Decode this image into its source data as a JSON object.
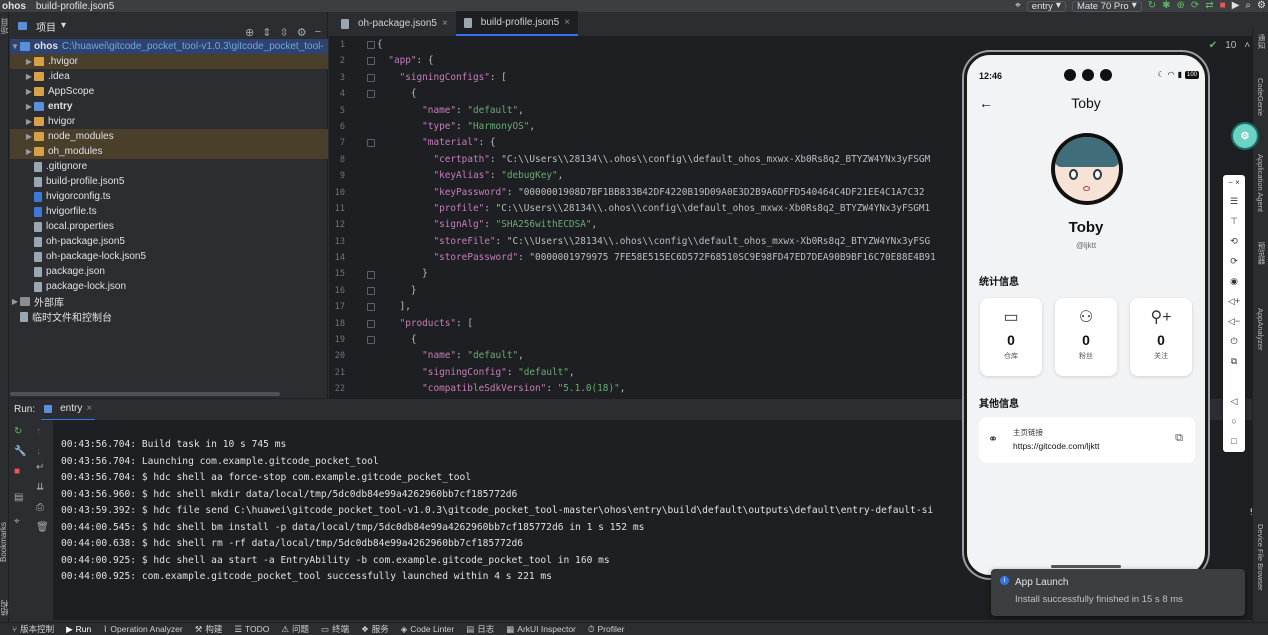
{
  "titlebar": {
    "project": "ohos",
    "file": "build-profile.json5",
    "run_config": "entry",
    "device": "Mate 70 Pro"
  },
  "project_panel": {
    "title": "项目",
    "root": {
      "name": "ohos",
      "path": "C:\\huawei\\gitcode_pocket_tool-v1.0.3\\gitcode_pocket_tool-"
    },
    "items": [
      {
        "name": ".hvigor",
        "type": "folder-excluded"
      },
      {
        "name": ".idea",
        "type": "folder"
      },
      {
        "name": "AppScope",
        "type": "folder"
      },
      {
        "name": "entry",
        "type": "folder-module"
      },
      {
        "name": "hvigor",
        "type": "folder"
      },
      {
        "name": "node_modules",
        "type": "folder-excluded"
      },
      {
        "name": "oh_modules",
        "type": "folder-excluded"
      },
      {
        "name": ".gitignore",
        "type": "file"
      },
      {
        "name": "build-profile.json5",
        "type": "file"
      },
      {
        "name": "hvigorconfig.ts",
        "type": "ts"
      },
      {
        "name": "hvigorfile.ts",
        "type": "ts"
      },
      {
        "name": "local.properties",
        "type": "file"
      },
      {
        "name": "oh-package.json5",
        "type": "file"
      },
      {
        "name": "oh-package-lock.json5",
        "type": "file"
      },
      {
        "name": "package.json",
        "type": "file"
      },
      {
        "name": "package-lock.json",
        "type": "file"
      }
    ],
    "external_libs": "外部库",
    "scratches": "临时文件和控制台"
  },
  "editor": {
    "tabs": [
      {
        "label": "oh-package.json5",
        "active": false
      },
      {
        "label": "build-profile.json5",
        "active": true
      }
    ],
    "inspection_count": "10",
    "lines": [
      {
        "n": "1",
        "t": "{"
      },
      {
        "n": "2",
        "t": "  \"app\": {"
      },
      {
        "n": "3",
        "t": "    \"signingConfigs\": ["
      },
      {
        "n": "4",
        "t": "      {"
      },
      {
        "n": "5",
        "t": "        \"name\": \"default\","
      },
      {
        "n": "6",
        "t": "        \"type\": \"HarmonyOS\","
      },
      {
        "n": "7",
        "t": "        \"material\": {"
      },
      {
        "n": "8",
        "t": "          \"certpath\": \"C:\\\\Users\\\\28134\\\\.ohos\\\\config\\\\default_ohos_mxwx-Xb0Rs8q2_BTYZW4YNx3yFSGM"
      },
      {
        "n": "9",
        "t": "          \"keyAlias\": \"debugKey\","
      },
      {
        "n": "10",
        "t": "          \"keyPassword\": \"0000001908D7BF1BB833B42DF4220B19D09A0E3D2B9A6DFFD540464C4DF21EE4C1A7C32"
      },
      {
        "n": "11",
        "t": "          \"profile\": \"C:\\\\Users\\\\28134\\\\.ohos\\\\config\\\\default_ohos_mxwx-Xb0Rs8q2_BTYZW4YNx3yFSGM1"
      },
      {
        "n": "12",
        "t": "          \"signAlg\": \"SHA256withECDSA\","
      },
      {
        "n": "13",
        "t": "          \"storeFile\": \"C:\\\\Users\\\\28134\\\\.ohos\\\\config\\\\default_ohos_mxwx-Xb0Rs8q2_BTYZW4YNx3yFSG"
      },
      {
        "n": "14",
        "t": "          \"storePassword\": \"0000001979975 7FE58E515EC6D572F68510SC9E98FD47ED7DEA90B9BF16C70E88E4B91"
      },
      {
        "n": "15",
        "t": "        }"
      },
      {
        "n": "16",
        "t": "      }"
      },
      {
        "n": "17",
        "t": "    ],"
      },
      {
        "n": "18",
        "t": "    \"products\": ["
      },
      {
        "n": "19",
        "t": "      {"
      },
      {
        "n": "20",
        "t": "        \"name\": \"default\","
      },
      {
        "n": "21",
        "t": "        \"signingConfig\": \"default\","
      },
      {
        "n": "22",
        "t": "        \"compatibleSdkVersion\": \"5.1.0(18)\","
      }
    ]
  },
  "run": {
    "label": "Run:",
    "tab": "entry",
    "log": [
      "00:43:56.704: Build task in 10 s 745 ms",
      "00:43:56.704: Launching com.example.gitcode_pocket_tool",
      "00:43:56.704: $ hdc shell aa force-stop com.example.gitcode_pocket_tool",
      "00:43:56.960: $ hdc shell mkdir data/local/tmp/5dc0db84e99a4262960bb7cf185772d6",
      "00:43:59.392: $ hdc file send C:\\huawei\\gitcode_pocket_tool-v1.0.3\\gitcode_pocket_tool-master\\ohos\\entry\\build\\default\\outputs\\default\\entry-default-si",
      "00:44:00.545: $ hdc shell bm install -p data/local/tmp/5dc0db84e99a4262960bb7cf185772d6 in 1 s 152 ms",
      "00:44:00.638: $ hdc shell rm -rf data/local/tmp/5dc0db84e99a4262960bb7cf185772d6",
      "00:44:00.925: $ hdc shell aa start -a EntryAbility -b com.example.gitcode_pocket_tool in 160 ms",
      "00:44:00.925: com.example.gitcode_pocket_tool successfully launched within 4 s 221 ms"
    ],
    "log_tail": "960bb7c"
  },
  "bottom_tabs": [
    "版本控制",
    "Run",
    "Operation Analyzer",
    "构建",
    "TODO",
    "问题",
    "终端",
    "服务",
    "Code Linter",
    "日志",
    "ArkUI Inspector",
    "Profiler"
  ],
  "left_strip": {
    "top": "项目",
    "mid": "Bookmarks",
    "bottom": "结构"
  },
  "right_strip": [
    "通知",
    "CodeGenie",
    "Application Agent",
    "预览器",
    "AppAnalyzer",
    "Device File Browser"
  ],
  "phone": {
    "time": "12:46",
    "battery": "100",
    "nav_title": "Toby",
    "username": "Toby",
    "handle": "@ljktt",
    "stats_title": "统计信息",
    "stats": [
      {
        "icon": "folder-icon",
        "value": "0",
        "label": "仓库"
      },
      {
        "icon": "followers-icon",
        "value": "0",
        "label": "粉丝"
      },
      {
        "icon": "add-user-icon",
        "value": "0",
        "label": "关注"
      }
    ],
    "other_title": "其他信息",
    "link_label": "主页链接",
    "link_url": "https://gitcode.com/ljktt"
  },
  "toast": {
    "title": "App Launch",
    "body": "Install successfully finished in 15 s 8 ms"
  },
  "colors": {
    "accent": "#3574f0",
    "editor_bg": "#1e1f22",
    "panel_bg": "#2b2d30",
    "string": "#6aab73",
    "key": "#c77dbb"
  }
}
